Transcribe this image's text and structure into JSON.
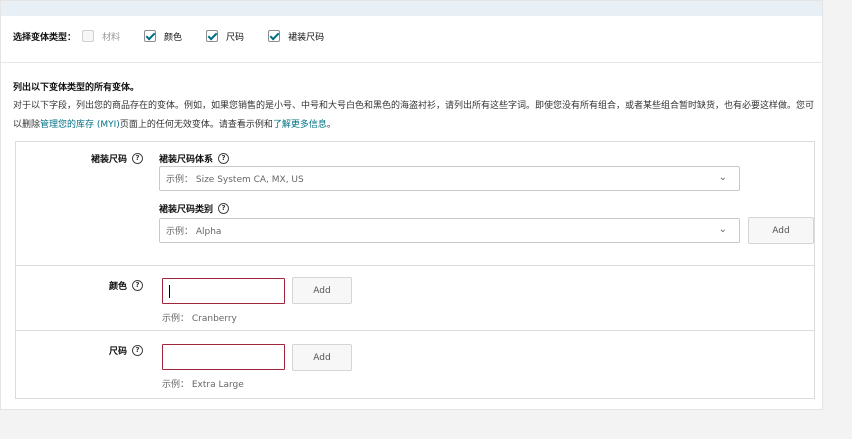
{
  "variation_types": {
    "label": "选择变体类型：",
    "options": [
      {
        "label": "材料",
        "checked": false,
        "disabled": true
      },
      {
        "label": "颜色",
        "checked": true,
        "disabled": false
      },
      {
        "label": "尺码",
        "checked": true,
        "disabled": false
      },
      {
        "label": "裙装尺码",
        "checked": true,
        "disabled": false
      }
    ]
  },
  "list_section": {
    "title": "列出以下变体类型的所有变体。",
    "desc_part1": "对于以下字段，列出您的商品存在的变体。例如，如果您销售的是小号、中号和大号白色和黑色的海盗衬衫，请列出所有这些字词。即使您没有所有组合，或者某些组合暂时缺货，也有必要这样做。您可以删除",
    "desc_link1": "管理您的库存 (MYI)",
    "desc_part2": "页面上的任何无效变体。请查看示例和",
    "desc_link2": "了解更多信息",
    "desc_end": "。"
  },
  "dress_size": {
    "label": "裙装尺码",
    "system_label": "裙装尺码体系",
    "system_placeholder": "示例： Size System CA, MX, US",
    "class_label": "裙装尺码类别",
    "class_placeholder": "示例： Alpha",
    "add_label": "Add"
  },
  "color": {
    "label": "颜色",
    "value": "",
    "add_label": "Add",
    "example": "示例： Cranberry"
  },
  "size": {
    "label": "尺码",
    "value": "",
    "add_label": "Add",
    "example": "示例： Extra Large"
  },
  "icons": {
    "help": "?",
    "chevron": "⌄"
  },
  "colors": {
    "accent_link": "#007185",
    "error_border": "#a0263c",
    "header_band": "#e8f0f5"
  }
}
